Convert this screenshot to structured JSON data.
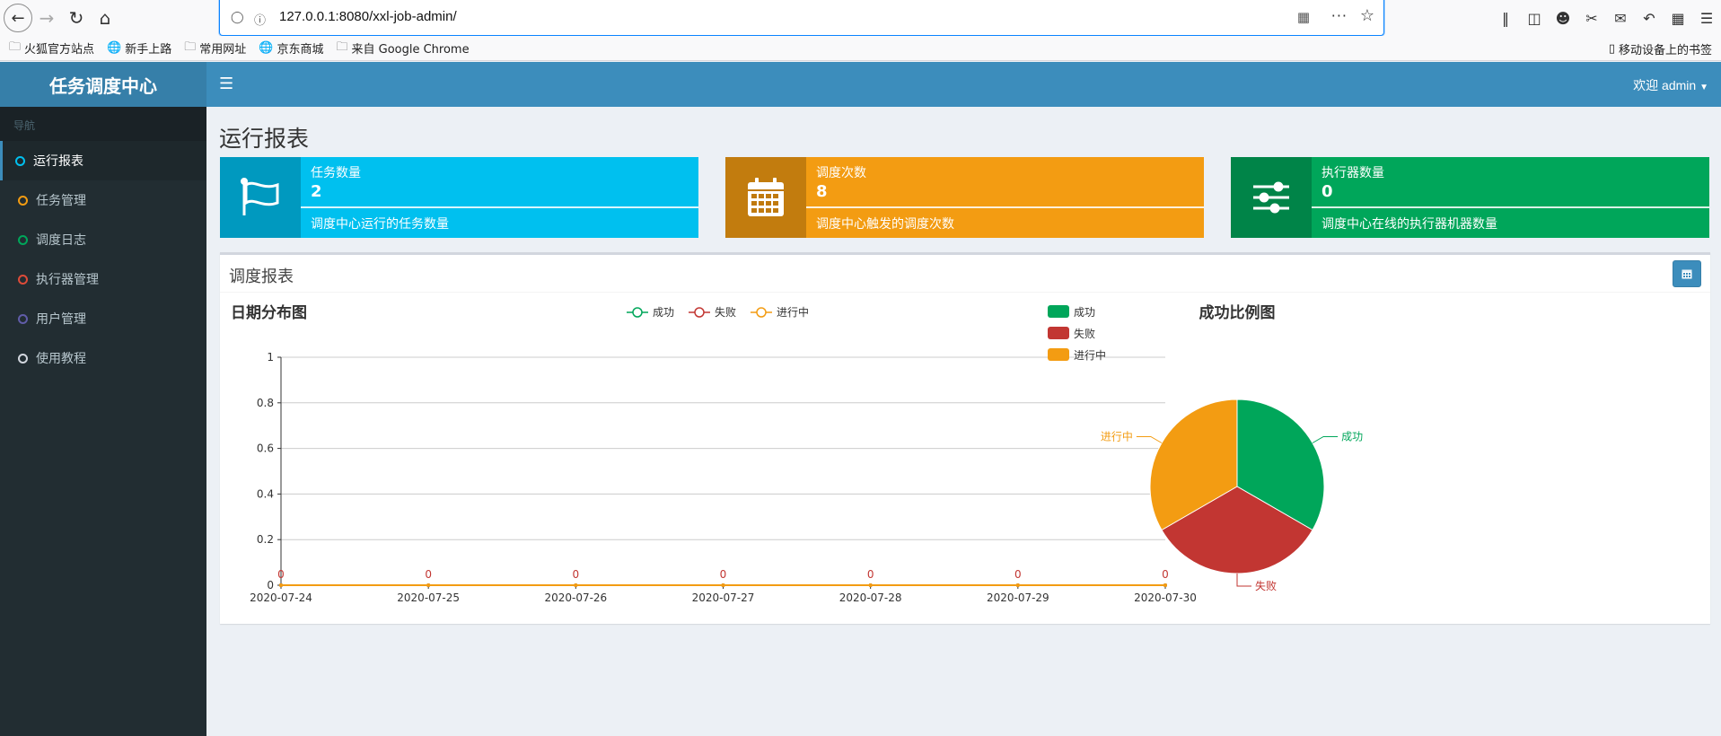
{
  "browser": {
    "url": "127.0.0.1:8080/xxl-job-admin/",
    "bookmarks": [
      "火狐官方站点",
      "新手上路",
      "常用网址",
      "京东商城",
      "来自 Google Chrome"
    ],
    "mobile_bookmarks": "移动设备上的书签"
  },
  "app": {
    "logo": "任务调度中心",
    "welcome": "欢迎 admin",
    "nav_header": "导航",
    "nav_items": [
      {
        "label": "运行报表",
        "color": "#00c0ef"
      },
      {
        "label": "任务管理",
        "color": "#f39c12"
      },
      {
        "label": "调度日志",
        "color": "#00a65a"
      },
      {
        "label": "执行器管理",
        "color": "#dd4b39"
      },
      {
        "label": "用户管理",
        "color": "#605ca8"
      },
      {
        "label": "使用教程",
        "color": "#d2d6de"
      }
    ],
    "page_title": "运行报表",
    "info_boxes": [
      {
        "label": "任务数量",
        "value": "2",
        "desc": "调度中心运行的任务数量",
        "color": "#00c0ef",
        "icon": "flag-icon"
      },
      {
        "label": "调度次数",
        "value": "8",
        "desc": "调度中心触发的调度次数",
        "color": "#f39c12",
        "icon": "calendar-icon"
      },
      {
        "label": "执行器数量",
        "value": "0",
        "desc": "调度中心在线的执行器机器数量",
        "color": "#00a65a",
        "icon": "sliders-icon"
      }
    ],
    "report_box_title": "调度报表"
  },
  "chart_data": [
    {
      "type": "line",
      "title": "日期分布图",
      "x": [
        "2020-07-24",
        "2020-07-25",
        "2020-07-26",
        "2020-07-27",
        "2020-07-28",
        "2020-07-29",
        "2020-07-30"
      ],
      "series": [
        {
          "name": "成功",
          "color": "#00a65a",
          "values": [
            0,
            0,
            0,
            0,
            0,
            0,
            0
          ]
        },
        {
          "name": "失败",
          "color": "#c23632",
          "values": [
            0,
            0,
            0,
            0,
            0,
            0,
            0
          ]
        },
        {
          "name": "进行中",
          "color": "#f39c12",
          "values": [
            0,
            0,
            0,
            0,
            0,
            0,
            0
          ]
        }
      ],
      "ylim": [
        0,
        1
      ],
      "yticks": [
        "0",
        "0.2",
        "0.4",
        "0.6",
        "0.8",
        "1"
      ],
      "legend": "top-center",
      "grid": true
    },
    {
      "type": "pie",
      "title": "成功比例图",
      "categories": [
        "成功",
        "失败",
        "进行中"
      ],
      "values": [
        1,
        1,
        1
      ],
      "colors": [
        "#00a65a",
        "#c23632",
        "#f39c12"
      ],
      "legend": "top-left"
    }
  ]
}
